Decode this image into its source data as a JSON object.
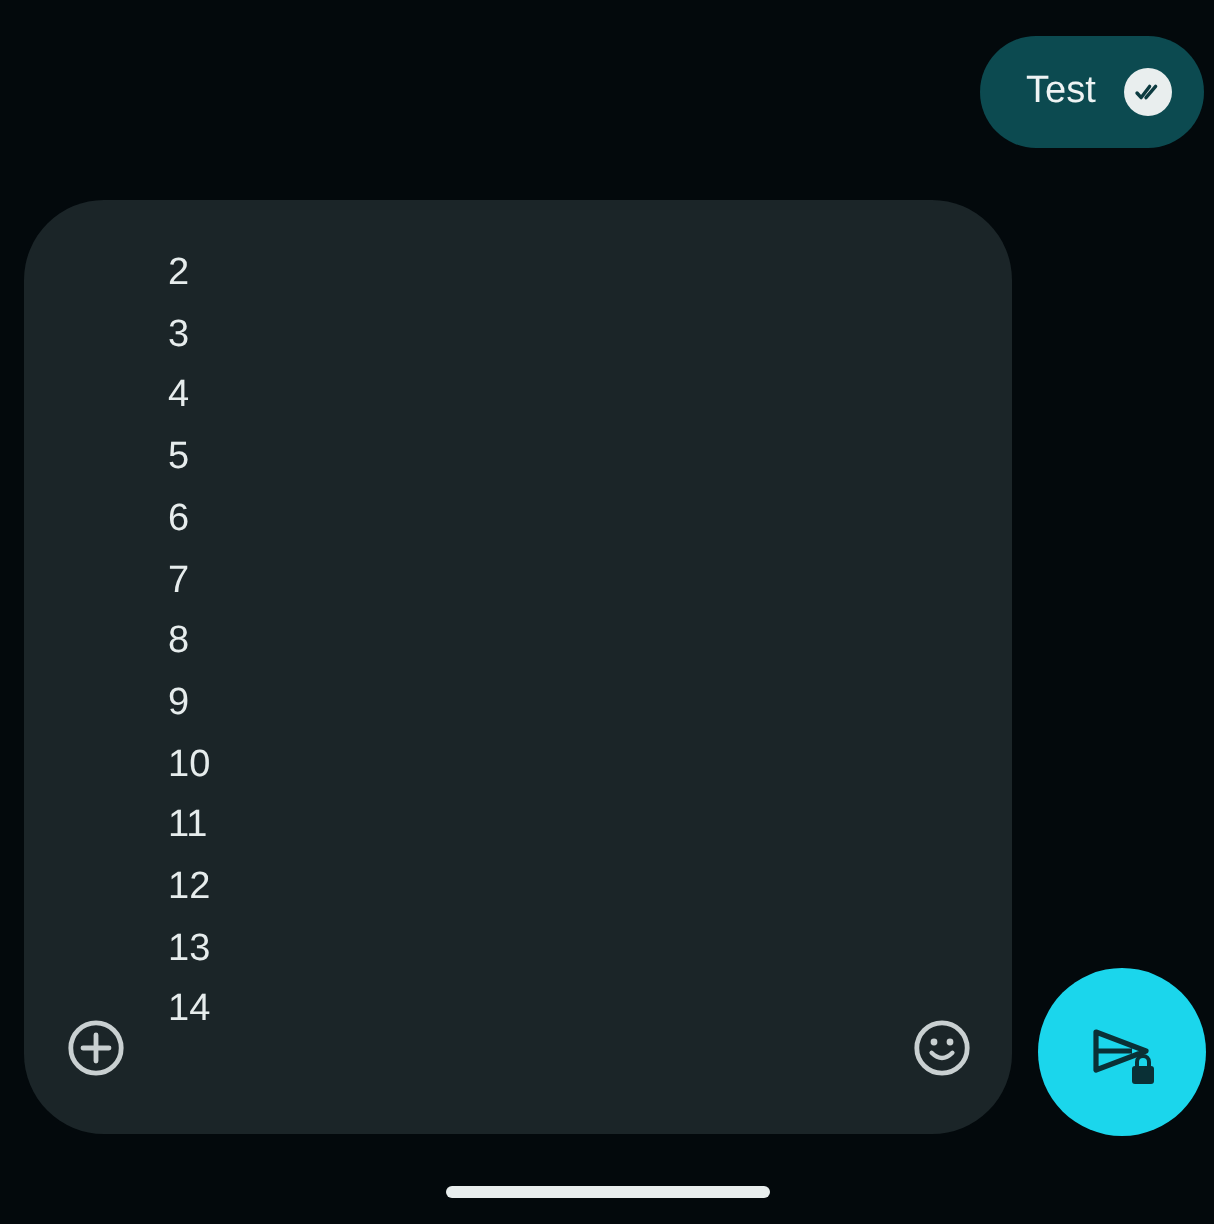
{
  "sent_message": {
    "text": "Test",
    "read": true
  },
  "composer": {
    "lines": [
      "2",
      "3",
      "4",
      "5",
      "6",
      "7",
      "8",
      "9",
      "10",
      "11",
      "12",
      "13",
      "14"
    ]
  }
}
